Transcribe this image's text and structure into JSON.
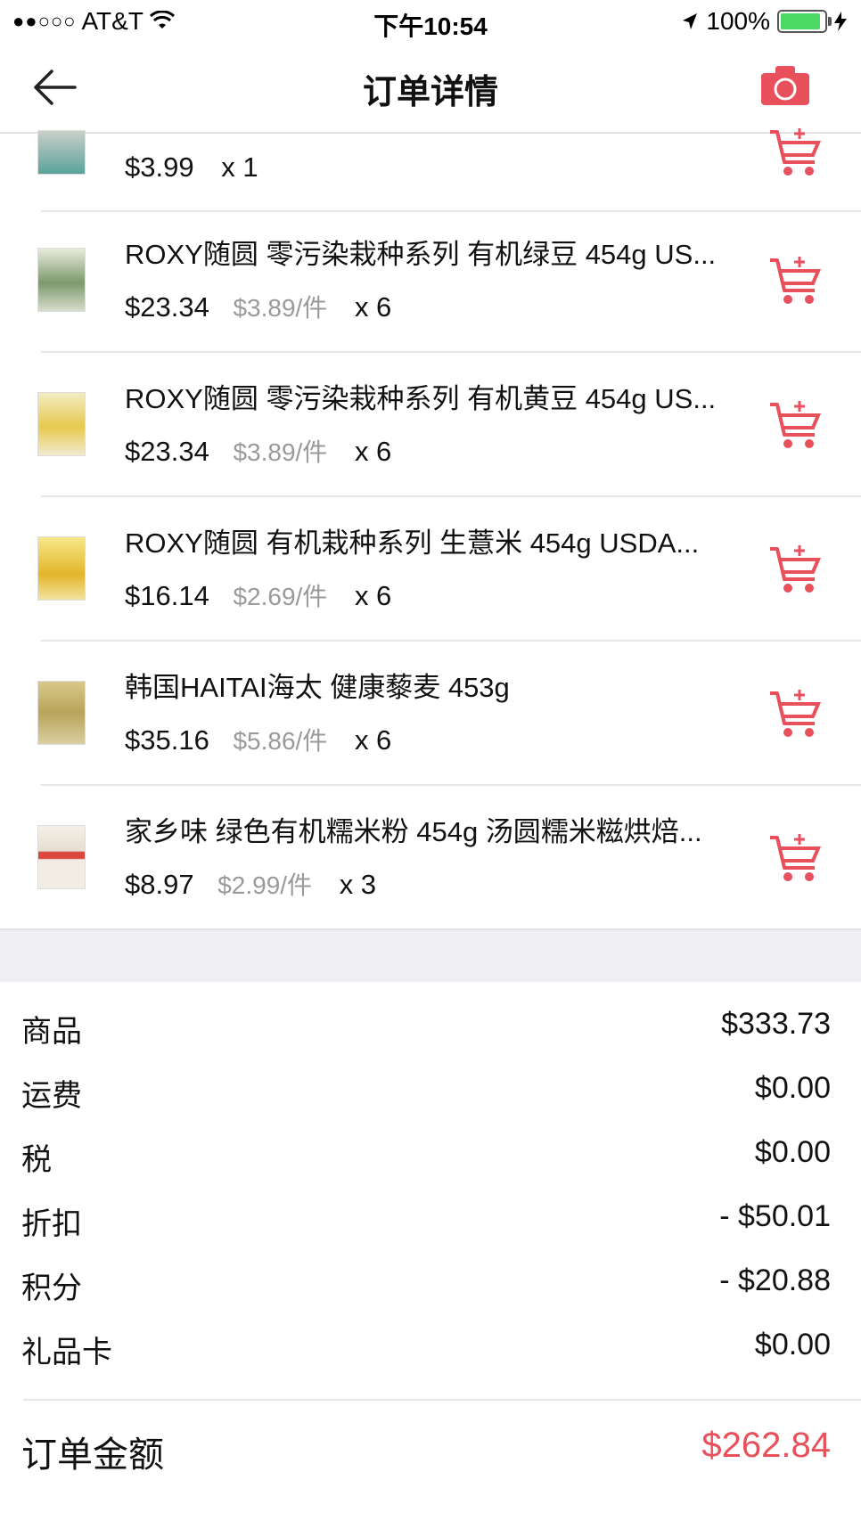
{
  "status_bar": {
    "carrier": "AT&T",
    "time": "下午10:54",
    "battery_pct": "100%"
  },
  "nav": {
    "title": "订单详情",
    "back_icon": "back-arrow-icon",
    "camera_icon": "camera-icon"
  },
  "colors": {
    "accent": "#e8505b",
    "battery": "#4cd964"
  },
  "items": [
    {
      "title": "",
      "price": "$3.99",
      "unit_price": "",
      "qty": "x 1"
    },
    {
      "title": "ROXY随圆 零污染栽种系列 有机绿豆 454g US...",
      "price": "$23.34",
      "unit_price": "$3.89/件",
      "qty": "x 6"
    },
    {
      "title": "ROXY随圆 零污染栽种系列 有机黄豆 454g US...",
      "price": "$23.34",
      "unit_price": "$3.89/件",
      "qty": "x 6"
    },
    {
      "title": "ROXY随圆 有机栽种系列 生薏米 454g USDA...",
      "price": "$16.14",
      "unit_price": "$2.69/件",
      "qty": "x 6"
    },
    {
      "title": "韩国HAITAI海太 健康藜麦 453g",
      "price": "$35.16",
      "unit_price": "$5.86/件",
      "qty": "x 6"
    },
    {
      "title": "家乡味 绿色有机糯米粉 454g 汤圆糯米糍烘焙...",
      "price": "$8.97",
      "unit_price": "$2.99/件",
      "qty": "x 3"
    }
  ],
  "summary": [
    {
      "label": "商品",
      "value": "$333.73"
    },
    {
      "label": "运费",
      "value": "$0.00"
    },
    {
      "label": "税",
      "value": "$0.00"
    },
    {
      "label": "折扣",
      "value": "- $50.01"
    },
    {
      "label": "积分",
      "value": "- $20.88"
    },
    {
      "label": "礼品卡",
      "value": "$0.00"
    }
  ],
  "total": {
    "label": "订单金额",
    "value": "$262.84"
  }
}
